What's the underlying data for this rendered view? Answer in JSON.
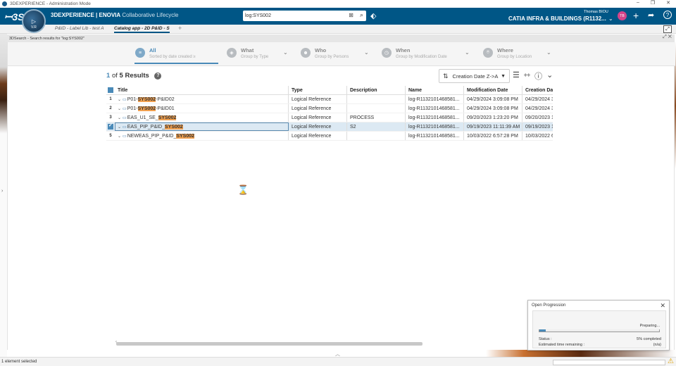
{
  "window": {
    "title": "3DEXPERIENCE - Administration Mode",
    "controls": [
      "–",
      "❐",
      "✕"
    ]
  },
  "topbar": {
    "brand_main": "3DEXPERIENCE | ENOVIA",
    "brand_sub": "Collaborative Lifecycle",
    "compass_version": "V.R",
    "search_value": "log:SYS002",
    "user_name": "Thomas BIOU",
    "platform_name": "CATIA INFRA & BUILDINGS (R1132...",
    "avatar_initials": "TB"
  },
  "tabs": [
    {
      "label": "P&ID - Label Lib - test A"
    },
    {
      "label": "Catalog app - 2D P&ID - S"
    }
  ],
  "panel": {
    "header": "3DSearch - Search results for \"log:SYS002\"",
    "controls": "⤢ ✕"
  },
  "facets": [
    {
      "title": "All",
      "subtitle": "Sorted by date created ≥"
    },
    {
      "title": "What",
      "subtitle": "Group by Type"
    },
    {
      "title": "Who",
      "subtitle": "Group by Persons"
    },
    {
      "title": "When",
      "subtitle": "Group by Modification Date"
    },
    {
      "title": "Where",
      "subtitle": "Group by Location"
    }
  ],
  "results": {
    "current": "1",
    "of_label": "of",
    "total": "5",
    "label": "Results"
  },
  "sort": {
    "label": "Creation Date Z->A"
  },
  "columns": {
    "title": "Title",
    "type": "Type",
    "description": "Description",
    "name": "Name",
    "modification_date": "Modification Date",
    "creation_date": "Creation Da"
  },
  "rows": [
    {
      "num": "1",
      "title_pre": "P01-",
      "title_hl": "SYS002",
      "title_post": "-P&ID02",
      "type": "Logical Reference",
      "description": "",
      "name": "log-R1132101468581...",
      "modified": "04/29/2024 3:09:08 PM",
      "created": "04/29/2024 3"
    },
    {
      "num": "2",
      "title_pre": "P01-",
      "title_hl": "SYS002",
      "title_post": "-P&ID01",
      "type": "Logical Reference",
      "description": "",
      "name": "log-R1132101468581...",
      "modified": "04/29/2024 3:09:08 PM",
      "created": "04/29/2024 3"
    },
    {
      "num": "3",
      "title_pre": "EAS_U1_SE_",
      "title_hl": "SYS002",
      "title_post": "",
      "type": "Logical Reference",
      "description": "PROCESS",
      "name": "log-R1132101468581...",
      "modified": "09/20/2023 1:23:20 PM",
      "created": "09/20/2023 1"
    },
    {
      "num": "",
      "title_pre": "EAS_PIP_P&ID_",
      "title_hl": "SYS002",
      "title_post": "",
      "type": "Logical Reference",
      "description": "S2",
      "name": "log-R1132101468581...",
      "modified": "09/19/2023 11:11:39 AM",
      "created": "09/19/2023 1"
    },
    {
      "num": "5",
      "title_pre": "NEWEAS_PIP_P&ID_",
      "title_hl": "SYS002",
      "title_post": "",
      "type": "Logical Reference",
      "description": "",
      "name": "log-R1132101468581...",
      "modified": "10/03/2022 6:57:28 PM",
      "created": "10/03/2022 6"
    }
  ],
  "progress": {
    "title": "Open Progression",
    "state": "Preparing...",
    "fraction": 0.05,
    "status_label": "Status :",
    "status_value": "5% completed",
    "eta_label": "Estimated time remaining :",
    "eta_value": "(n/a)"
  },
  "statusbar": {
    "text": "1 element selected"
  },
  "colors": {
    "topbar": "#005686",
    "accent": "#4a8ab8",
    "highlight": "#f0a050",
    "selected_row": "#dce9f3"
  }
}
